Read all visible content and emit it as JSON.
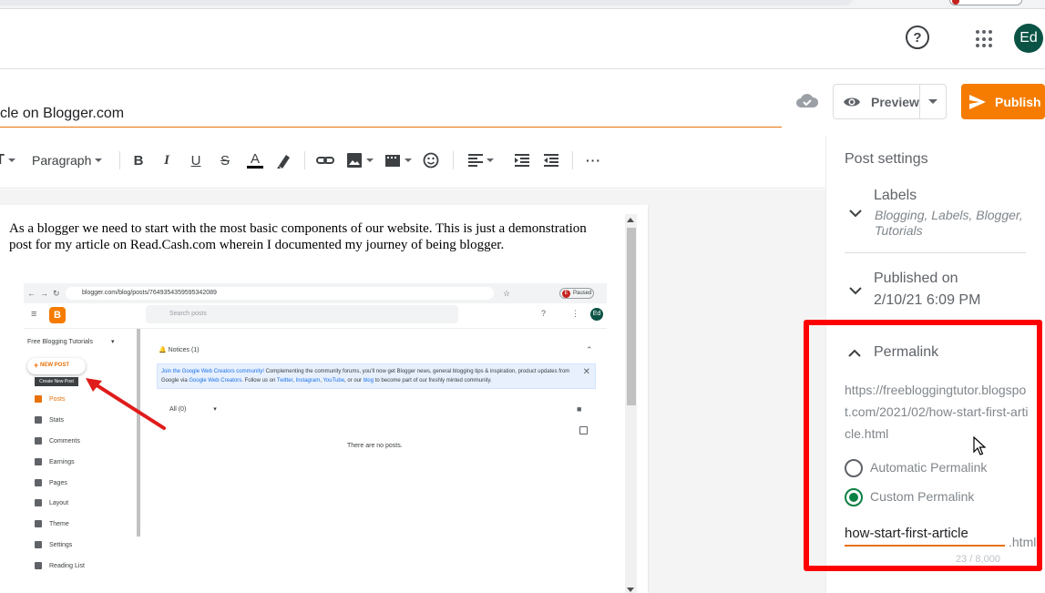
{
  "header": {
    "help_glyph": "?",
    "avatar_initials": "Ed"
  },
  "post": {
    "title_visible": "cle on Blogger.com"
  },
  "actions": {
    "preview_label": "Preview",
    "publish_label": "Publish"
  },
  "toolbar": {
    "paragraph_label": "Paragraph",
    "items": [
      "text-size",
      "bold",
      "italic",
      "underline",
      "strikethrough",
      "text-color",
      "highlight",
      "link",
      "image",
      "video",
      "emoji",
      "align",
      "indent",
      "outdent",
      "more"
    ]
  },
  "editor": {
    "body_text": "As a blogger we need to start with the most basic components of our website. This is just a demonstration post for my article on Read.Cash.com wherein I documented my journey of being blogger.",
    "screenshot": {
      "url": "blogger.com/blog/posts/7649354359595342089",
      "paused_label": "Paused",
      "extension_letter": "E",
      "logo_letter": "B",
      "search_placeholder": "Search posts",
      "avatar": "Ed",
      "blog_name": "Free Blogging Tutorials",
      "new_post_label": "NEW POST",
      "tooltip": "Create New Post",
      "sidebar": [
        {
          "label": "Posts"
        },
        {
          "label": "Stats"
        },
        {
          "label": "Comments"
        },
        {
          "label": "Earnings"
        },
        {
          "label": "Pages"
        },
        {
          "label": "Layout"
        },
        {
          "label": "Theme"
        },
        {
          "label": "Settings"
        },
        {
          "label": "Reading List"
        }
      ],
      "notices_label": "Notices (1)",
      "banner": {
        "link1": "Join the Google Web Creators community!",
        "text1": " Complementing the community forums, you'll now get Blogger news, general blogging tips & inspiration, product updates from Google via ",
        "link2": "Google Web Creators",
        "text2": ". Follow us on ",
        "link3": "Twitter",
        "sep1": ", ",
        "link4": "Instagram",
        "sep2": ", ",
        "link5": "YouTube",
        "text3": ", or our ",
        "link6": "blog",
        "text4": " to become part of our freshly minted community."
      },
      "filter_label": "All (0)",
      "empty_text": "There are no posts."
    }
  },
  "settings": {
    "title": "Post settings",
    "labels": {
      "heading": "Labels",
      "value": "Blogging, Labels, Blogger, Tutorials"
    },
    "published": {
      "heading": "Published on",
      "value": "2/10/21 6:09 PM"
    },
    "permalink": {
      "heading": "Permalink",
      "url": "https://freebloggingtutor.blogspot.com/2021/02/how-start-first-article.html",
      "options": [
        {
          "label": "Automatic Permalink",
          "selected": false
        },
        {
          "label": "Custom Permalink",
          "selected": true
        }
      ],
      "slug": "how-start-first-article",
      "suffix": ".html",
      "char_count": "23 / 8,000"
    }
  },
  "colors": {
    "accent": "#e8710a",
    "publish": "#f57c00",
    "highlight_box": "#ff0000",
    "radio_on": "#0b8043",
    "avatar": "#0b5345"
  }
}
